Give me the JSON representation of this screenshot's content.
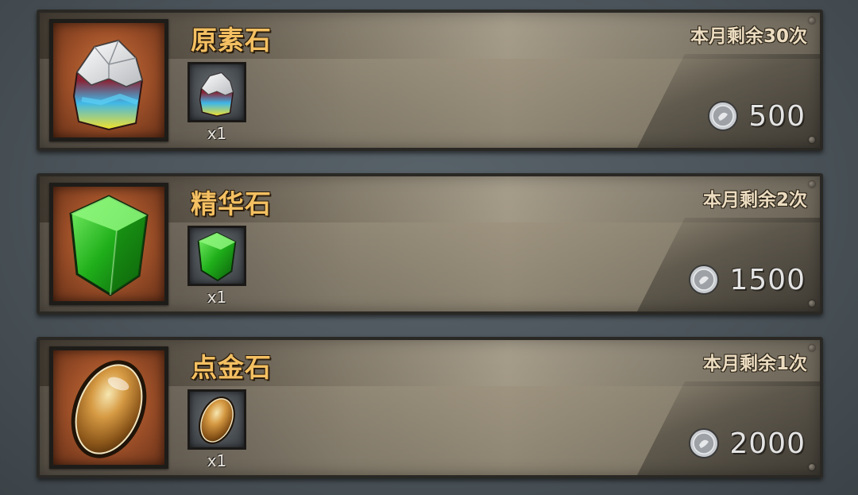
{
  "items": [
    {
      "name": "原素石",
      "remaining": "本月剩余30次",
      "quantity": "x1",
      "price": "500",
      "icon": "raw-crystal-icon"
    },
    {
      "name": "精华石",
      "remaining": "本月剩余2次",
      "quantity": "x1",
      "price": "1500",
      "icon": "green-crystal-icon"
    },
    {
      "name": "点金石",
      "remaining": "本月剩余1次",
      "quantity": "x1",
      "price": "2000",
      "icon": "gold-stone-icon"
    }
  ],
  "currency_icon": "silver-coin-icon",
  "colors": {
    "title": "#f4c062",
    "remaining_text": "#ecdcc0",
    "price_text": "#e4e4e4",
    "big_frame_bg": "#a3532a"
  }
}
